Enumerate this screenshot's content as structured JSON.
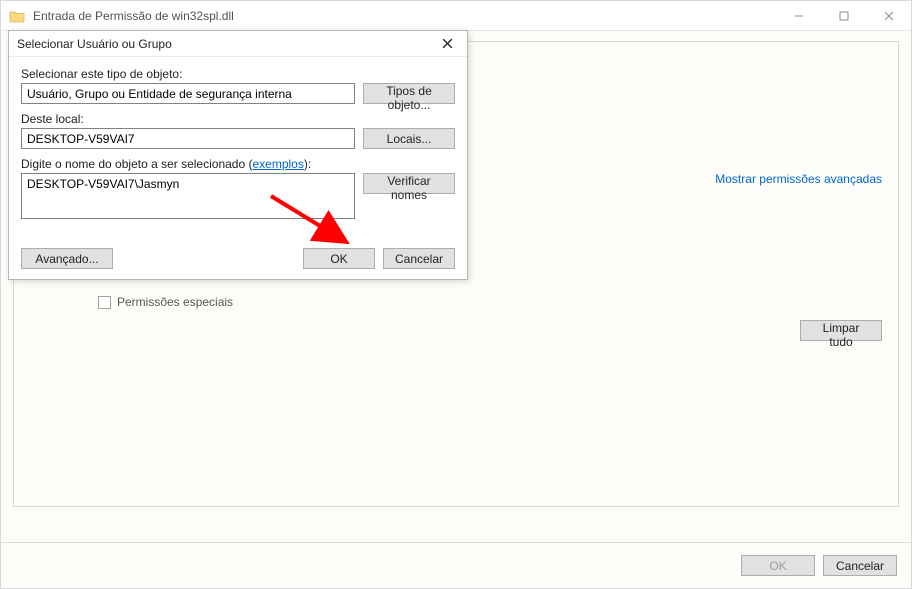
{
  "parent": {
    "title": "Entrada de Permissão de win32spl.dll",
    "advanced_perms_link": "Mostrar permissões avançadas",
    "special_perms_label": "Permissões especiais",
    "clear_all": "Limpar tudo",
    "ok": "OK",
    "cancel": "Cancelar"
  },
  "dialog": {
    "title": "Selecionar Usuário ou Grupo",
    "object_type_label": "Selecionar este tipo de objeto:",
    "object_type_value": "Usuário, Grupo ou Entidade de segurança interna",
    "object_type_btn": "Tipos de objeto...",
    "location_label": "Deste local:",
    "location_value": "DESKTOP-V59VAI7",
    "location_btn": "Locais...",
    "name_label_prefix": "Digite o nome do objeto a ser selecionado (",
    "name_label_link": "exemplos",
    "name_label_suffix": "):",
    "name_value": "DESKTOP-V59VAI7\\Jasmyn",
    "verify_btn": "Verificar nomes",
    "advanced_btn": "Avançado...",
    "ok": "OK",
    "cancel": "Cancelar"
  }
}
